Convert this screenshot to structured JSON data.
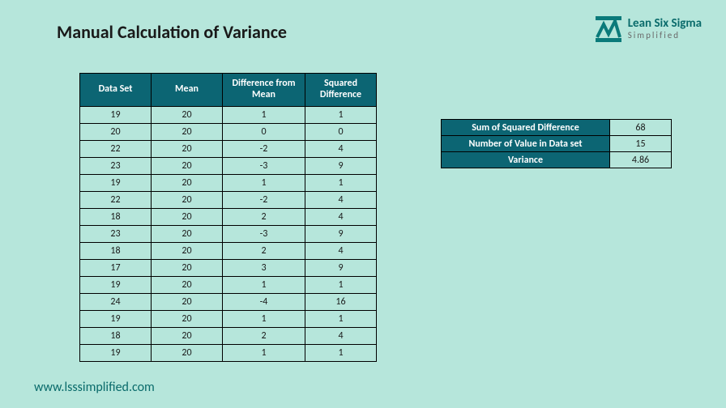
{
  "title": "Manual Calculation of Variance",
  "logo": {
    "line1": "Lean Six Sigma",
    "line2": "Simplified"
  },
  "footer": "www.lsssimplified.com",
  "table": {
    "headers": [
      "Data Set",
      "Mean",
      "Difference from Mean",
      "Squared Difference"
    ],
    "rows": [
      {
        "ds": "19",
        "mean": "20",
        "diff": "1",
        "sq": "1"
      },
      {
        "ds": "20",
        "mean": "20",
        "diff": "0",
        "sq": "0"
      },
      {
        "ds": "22",
        "mean": "20",
        "diff": "-2",
        "sq": "4"
      },
      {
        "ds": "23",
        "mean": "20",
        "diff": "-3",
        "sq": "9"
      },
      {
        "ds": "19",
        "mean": "20",
        "diff": "1",
        "sq": "1"
      },
      {
        "ds": "22",
        "mean": "20",
        "diff": "-2",
        "sq": "4"
      },
      {
        "ds": "18",
        "mean": "20",
        "diff": "2",
        "sq": "4"
      },
      {
        "ds": "23",
        "mean": "20",
        "diff": "-3",
        "sq": "9"
      },
      {
        "ds": "18",
        "mean": "20",
        "diff": "2",
        "sq": "4"
      },
      {
        "ds": "17",
        "mean": "20",
        "diff": "3",
        "sq": "9"
      },
      {
        "ds": "19",
        "mean": "20",
        "diff": "1",
        "sq": "1"
      },
      {
        "ds": "24",
        "mean": "20",
        "diff": "-4",
        "sq": "16"
      },
      {
        "ds": "19",
        "mean": "20",
        "diff": "1",
        "sq": "1"
      },
      {
        "ds": "18",
        "mean": "20",
        "diff": "2",
        "sq": "4"
      },
      {
        "ds": "19",
        "mean": "20",
        "diff": "1",
        "sq": "1"
      }
    ]
  },
  "summary": [
    {
      "label": "Sum of Squared Difference",
      "value": "68"
    },
    {
      "label": "Number of Value in Data set",
      "value": "15"
    },
    {
      "label": "Variance",
      "value": "4.86"
    }
  ],
  "chart_data": {
    "type": "table",
    "title": "Manual Calculation of Variance",
    "columns": [
      "Data Set",
      "Mean",
      "Difference from Mean",
      "Squared Difference"
    ],
    "data_set": [
      19,
      20,
      22,
      23,
      19,
      22,
      18,
      23,
      18,
      17,
      19,
      24,
      19,
      18,
      19
    ],
    "mean": 20,
    "difference_from_mean": [
      1,
      0,
      -2,
      -3,
      1,
      -2,
      2,
      -3,
      2,
      3,
      1,
      -4,
      1,
      2,
      1
    ],
    "squared_difference": [
      1,
      0,
      4,
      9,
      1,
      4,
      4,
      9,
      4,
      9,
      1,
      16,
      1,
      4,
      1
    ],
    "sum_of_squared_difference": 68,
    "n": 15,
    "variance": 4.86
  }
}
